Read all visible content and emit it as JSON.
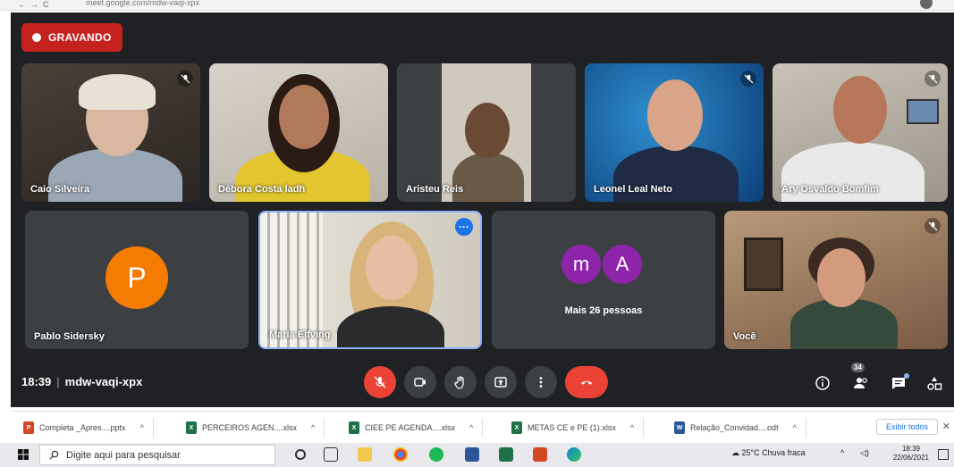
{
  "browser": {
    "url": "meet.google.com/mdw-vaqi-xpx"
  },
  "recording": {
    "label": "GRAVANDO",
    "color": "#c5221f"
  },
  "participants": [
    {
      "name": "Caio Silveira",
      "muted": true
    },
    {
      "name": "Débora Costa ladh",
      "muted": false
    },
    {
      "name": "Aristeu Reis",
      "muted": false
    },
    {
      "name": "Leonel Leal Neto",
      "muted": true
    },
    {
      "name": "Ary Osvaldo Bomfim",
      "muted": true
    },
    {
      "name": "Pablo Sidersky",
      "initial": "P",
      "avatar_color": "#f57c00"
    },
    {
      "name": "Maria Elfving",
      "muted": false,
      "active": true
    },
    {
      "name": "Você",
      "muted": true
    }
  ],
  "more_tile": {
    "avatars": [
      "m",
      "A"
    ],
    "label": "Mais 26 pessoas"
  },
  "meeting": {
    "time": "18:39",
    "code": "mdw-vaqi-xpx",
    "participant_count": "34"
  },
  "colors": {
    "accent_blue": "#1a73e8",
    "danger": "#ea4335",
    "panel": "#202124",
    "tile": "#3c4043"
  },
  "icons": [
    "mic-off-icon",
    "camera-icon",
    "raise-hand-icon",
    "present-icon",
    "more-vert-icon",
    "call-end-icon",
    "info-icon",
    "people-icon",
    "chat-icon",
    "activities-icon"
  ],
  "downloads": {
    "items": [
      {
        "name": "Completa _Apres....pptx",
        "color": "#d24726"
      },
      {
        "name": "PERCEIROS AGEN....xlsx",
        "color": "#1e7145"
      },
      {
        "name": "CIEE PE AGENDA....xlsx",
        "color": "#1e7145"
      },
      {
        "name": "METAS CE e PE (1).xlsx",
        "color": "#1e7145"
      },
      {
        "name": "Relação_Convidad....odt",
        "color": "#2b579a"
      }
    ],
    "show_all": "Exibir todos",
    "close": "✕"
  },
  "taskbar": {
    "search_placeholder": "Digite aqui para pesquisar",
    "weather": "25°C Chuva fraca",
    "time": "18:39",
    "date": "22/06/2021"
  }
}
